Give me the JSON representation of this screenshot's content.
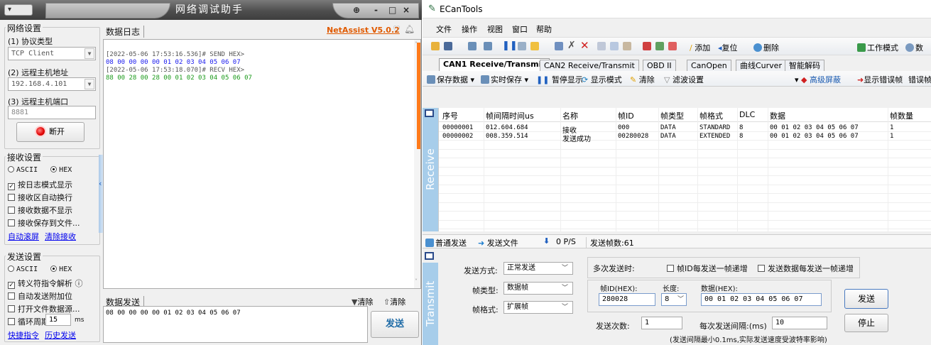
{
  "netassist": {
    "sysmenu": "",
    "title": "网络调试助手",
    "ctrl_pin": "",
    "ctrl_min": "-",
    "ctrl_max": "□",
    "ctrl_close": "×",
    "net_settings": {
      "group": "网络设置",
      "protocol_label": "(1) 协议类型",
      "protocol_value": "TCP Client",
      "host_label": "(2) 远程主机地址",
      "host_value": "192.168.4.101",
      "port_label": "(3) 远程主机端口",
      "port_value": "8881",
      "disconnect_label": "断开"
    },
    "recv_settings": {
      "group": "接收设置",
      "ascii": "ASCII",
      "hex": "HEX",
      "opt1": "按日志模式显示",
      "opt2": "接收区自动换行",
      "opt3": "接收数据不显示",
      "opt4": "接收保存到文件...",
      "link1": "自动滚屏",
      "link2": "清除接收"
    },
    "send_settings": {
      "group": "发送设置",
      "ascii": "ASCII",
      "hex": "HEX",
      "opt1": "转义符指令解析 ⓘ",
      "opt2": "自动发送附加位",
      "opt3": "打开文件数据源...",
      "opt4": "循环周期",
      "period_value": "15",
      "period_unit": "ms",
      "link1": "快捷指令",
      "link2": "历史发送"
    },
    "log": {
      "label": "数据日志",
      "brand": "NetAssist V5.0.2",
      "lines": [
        {
          "text": "[2022-05-06 17:53:16.536]# SEND HEX>",
          "color": "#555555"
        },
        {
          "text": "08 00 00 00 00 01 02 03 04 05 06 07",
          "color": "#1a1aee"
        },
        {
          "text": "[2022-05-06 17:53:18.070]# RECV HEX>",
          "color": "#555555"
        },
        {
          "text": "88 00 28 00 28 00 01 02 03 04 05 06 07",
          "color": "#1a9a1a"
        }
      ]
    },
    "send": {
      "label": "数据发送",
      "clear1": "清除",
      "clear2": "清除",
      "content": "08 00 00 00 00 01 02 03 04 05 06 07",
      "button": "发送"
    }
  },
  "ecantools": {
    "title": "ECanTools",
    "menu": [
      "文件",
      "操作",
      "视图",
      "窗口",
      "帮助"
    ],
    "toolbar": {
      "add": "添加",
      "reset": "复位",
      "delete": "删除",
      "work_mode": "工作模式",
      "data": "数"
    },
    "tabs": [
      "CAN1 Receive/Transmit",
      "CAN2 Receive/Transmit",
      "OBD II",
      "CanOpen",
      "曲线Curver",
      "智能解码"
    ],
    "subtoolbar": {
      "save": "保存数据",
      "realtime": "实时保存",
      "pause": "暂停显示",
      "display_mode": "显示模式",
      "clear": "清除",
      "filter": "滤波设置",
      "advanced": "高级屏蔽",
      "show_err": "显示错误帧",
      "err_rate": "错误帧率"
    },
    "receive_tag": "Receive",
    "transmit_tag": "Transmit",
    "columns": [
      "序号",
      "帧间隔时间us",
      "名称",
      "帧ID",
      "帧类型",
      "帧格式",
      "DLC",
      "数据",
      "帧数量"
    ],
    "rows": [
      [
        "00000001",
        "012.604.684",
        "接收",
        "000",
        "DATA",
        "STANDARD",
        "8",
        "00 01 02 03 04 05 06 07",
        "1"
      ],
      [
        "00000002",
        "008.359.514",
        "发送成功",
        "00280028",
        "DATA",
        "EXTENDED",
        "8",
        "00 01 02 03 04 05 06 07",
        "1"
      ]
    ],
    "send_bar": {
      "normal": "普通发送",
      "file": "发送文件",
      "rate": "0 P/S",
      "count": "发送帧数:61"
    },
    "form": {
      "mode_label": "发送方式:",
      "mode_value": "正常发送",
      "type_label": "帧类型:",
      "type_value": "数据帧",
      "format_label": "帧格式:",
      "format_value": "扩展帧",
      "multi_label": "多次发送时:",
      "inc_id": "帧ID每发送一帧递增",
      "inc_data": "发送数据每发送一帧递增",
      "id_label": "帧ID(HEX):",
      "id_value": "280028",
      "len_label": "长度:",
      "len_value": "8",
      "data_label": "数据(HEX):",
      "data_value": "00 01 02 03 04 05 06 07",
      "count_label": "发送次数:",
      "count_value": "1",
      "interval_label": "每次发送间隔:(ms)",
      "interval_value": "10",
      "note": "(发送间隔最小0.1ms,实际发送速度受波特率影响)",
      "send_btn": "发送",
      "stop_btn": "停止"
    }
  }
}
